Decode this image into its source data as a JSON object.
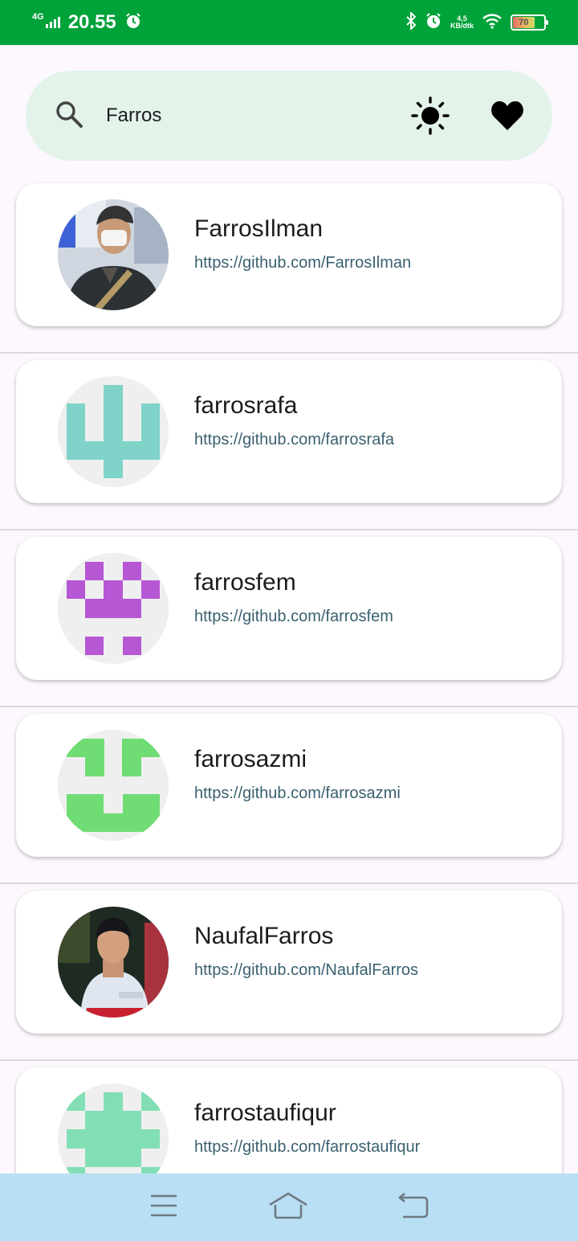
{
  "status_bar": {
    "network": "4G",
    "time": "20.55",
    "speed_value": "4,5",
    "speed_unit": "KB/dtk",
    "battery": "70"
  },
  "search": {
    "query": "Farros",
    "search_icon": "search-icon",
    "theme_icon": "sun-icon",
    "favorite_icon": "heart-icon"
  },
  "users": [
    {
      "username": "FarrosIlman",
      "url": "https://github.com/FarrosIlman",
      "avatar": "photo"
    },
    {
      "username": "farrosrafa",
      "url": "https://github.com/farrosrafa",
      "avatar": "identicon",
      "color": "#7fd3c9"
    },
    {
      "username": "farrosfem",
      "url": "https://github.com/farrosfem",
      "avatar": "identicon",
      "color": "#b657d4"
    },
    {
      "username": "farrosazmi",
      "url": "https://github.com/farrosazmi",
      "avatar": "identicon",
      "color": "#6fdc74"
    },
    {
      "username": "NaufalFarros",
      "url": "https://github.com/NaufalFarros",
      "avatar": "photo"
    },
    {
      "username": "farrostaufiqur",
      "url": "https://github.com/farrostaufiqur",
      "avatar": "identicon",
      "color": "#82dfb5"
    }
  ],
  "nav_bar": {
    "menu_icon": "menu-icon",
    "home_icon": "home-icon",
    "back_icon": "back-icon"
  }
}
